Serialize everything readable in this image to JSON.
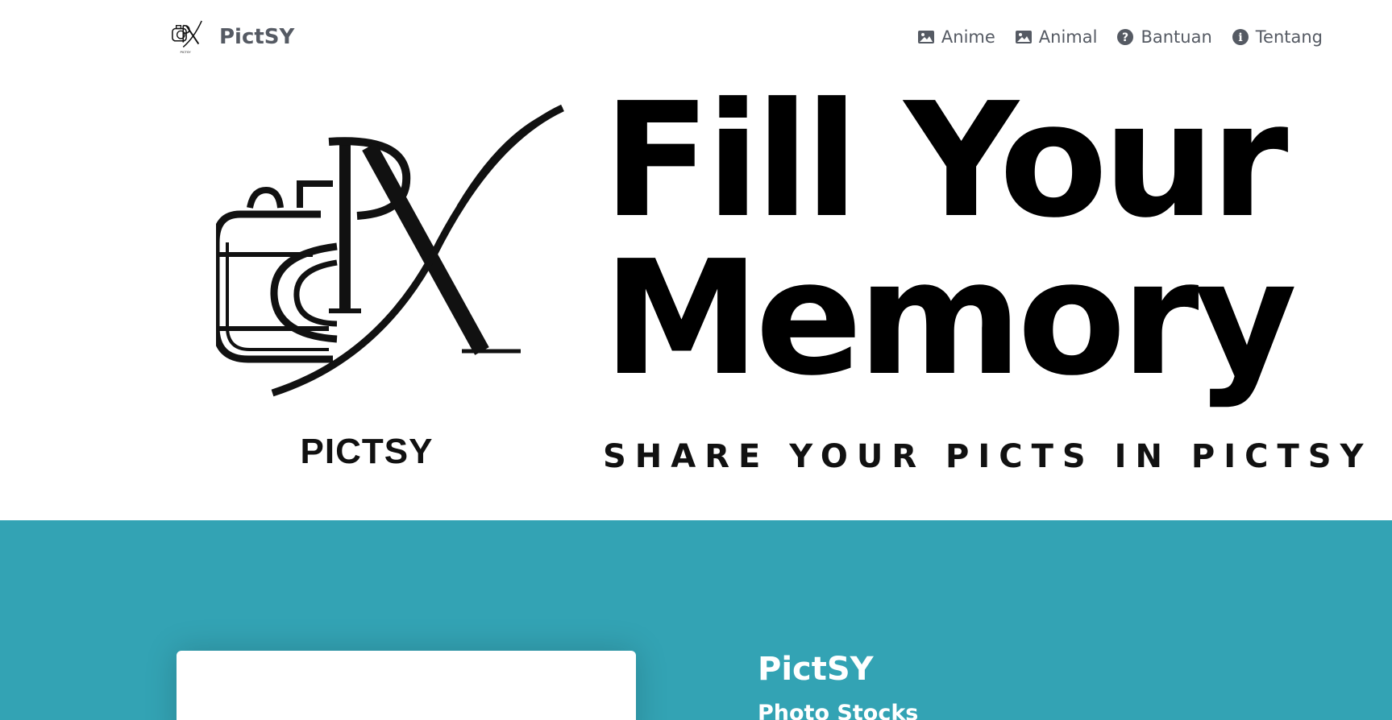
{
  "navbar": {
    "brand": {
      "text": "PictSY",
      "logo_icon": "pictsy-camera-logo-icon"
    },
    "links": [
      {
        "label": "Anime",
        "icon": "image-icon"
      },
      {
        "label": "Animal",
        "icon": "image-icon"
      },
      {
        "label": "Bantuan",
        "icon": "question-circle-icon"
      },
      {
        "label": "Tentang",
        "icon": "info-circle-icon"
      }
    ]
  },
  "hero": {
    "logo_word": "PICTSY",
    "title_line1": "Fill Your",
    "title_line2": "Memory",
    "tagline": "SHARE YOUR PICTS IN PICTSY"
  },
  "about": {
    "title": "PictSY",
    "subtitle": "Photo Stocks"
  },
  "colors": {
    "section_bg": "#33a3b4",
    "nav_text": "#555a63",
    "hero_text": "#000000"
  }
}
